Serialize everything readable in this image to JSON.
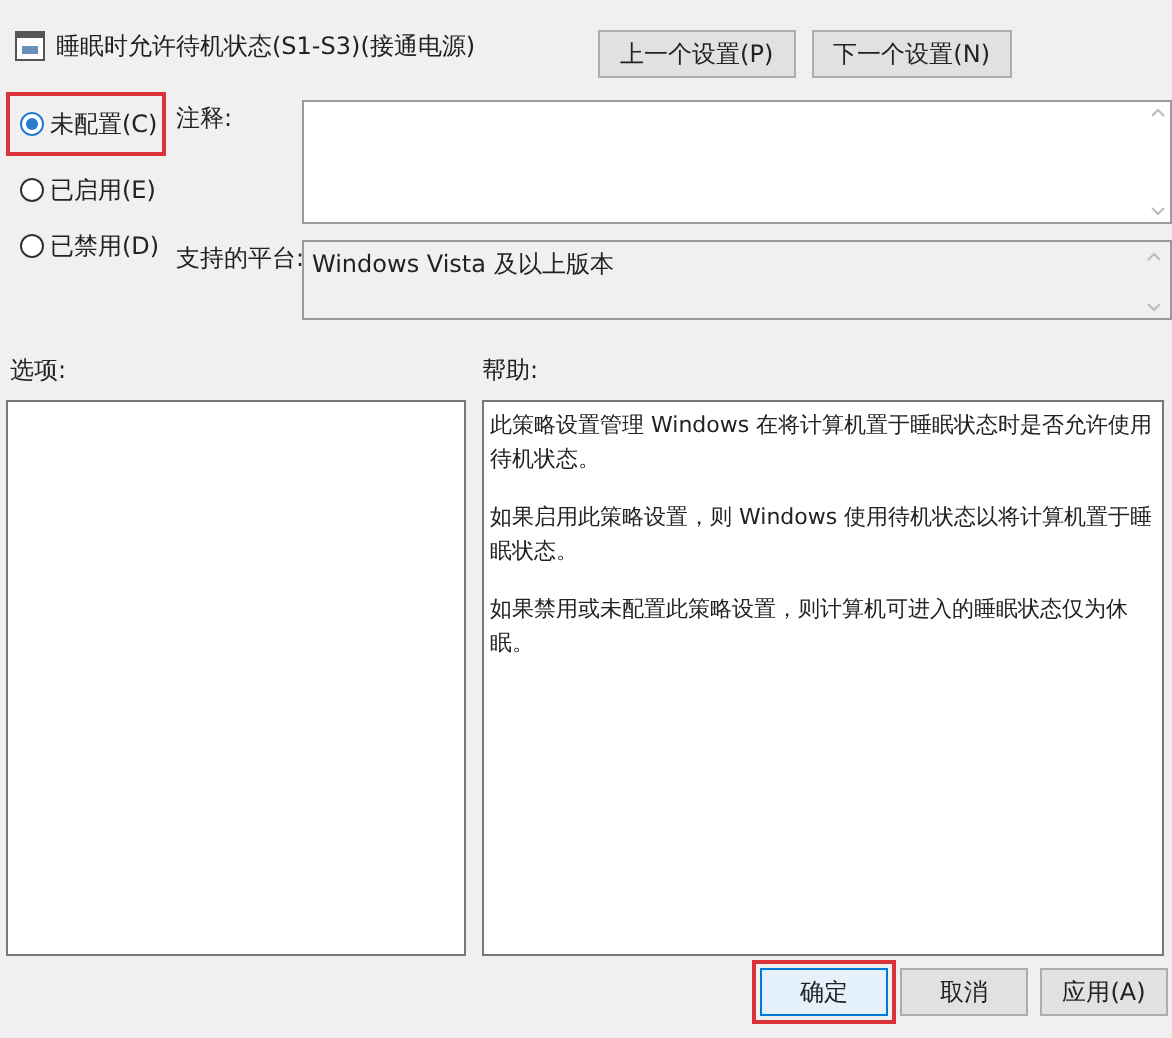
{
  "window": {
    "title": "睡眠时允许待机状态(S1-S3)(接通电源)"
  },
  "nav_buttons": [
    {
      "label": "上一个设置(P)"
    },
    {
      "label": "下一个设置(N)"
    }
  ],
  "radios": [
    {
      "label": "未配置(C)",
      "selected": true,
      "highlighted": true
    },
    {
      "label": "已启用(E)",
      "selected": false,
      "highlighted": false
    },
    {
      "label": "已禁用(D)",
      "selected": false,
      "highlighted": false
    }
  ],
  "comment": {
    "label": "注释:"
  },
  "platform": {
    "label": "支持的平台:",
    "value": "Windows Vista 及以上版本"
  },
  "options": {
    "label": "选项:"
  },
  "help": {
    "label": "帮助:",
    "paragraphs": [
      "此策略设置管理 Windows 在将计算机置于睡眠状态时是否允许使用待机状态。",
      "如果启用此策略设置，则 Windows 使用待机状态以将计算机置于睡眠状态。",
      "如果禁用或未配置此策略设置，则计算机可进入的睡眠状态仅为休眠。"
    ]
  },
  "buttons": [
    {
      "label": "确定",
      "highlighted": true
    },
    {
      "label": "取消",
      "highlighted": false
    },
    {
      "label": "应用(A)",
      "highlighted": false
    }
  ]
}
